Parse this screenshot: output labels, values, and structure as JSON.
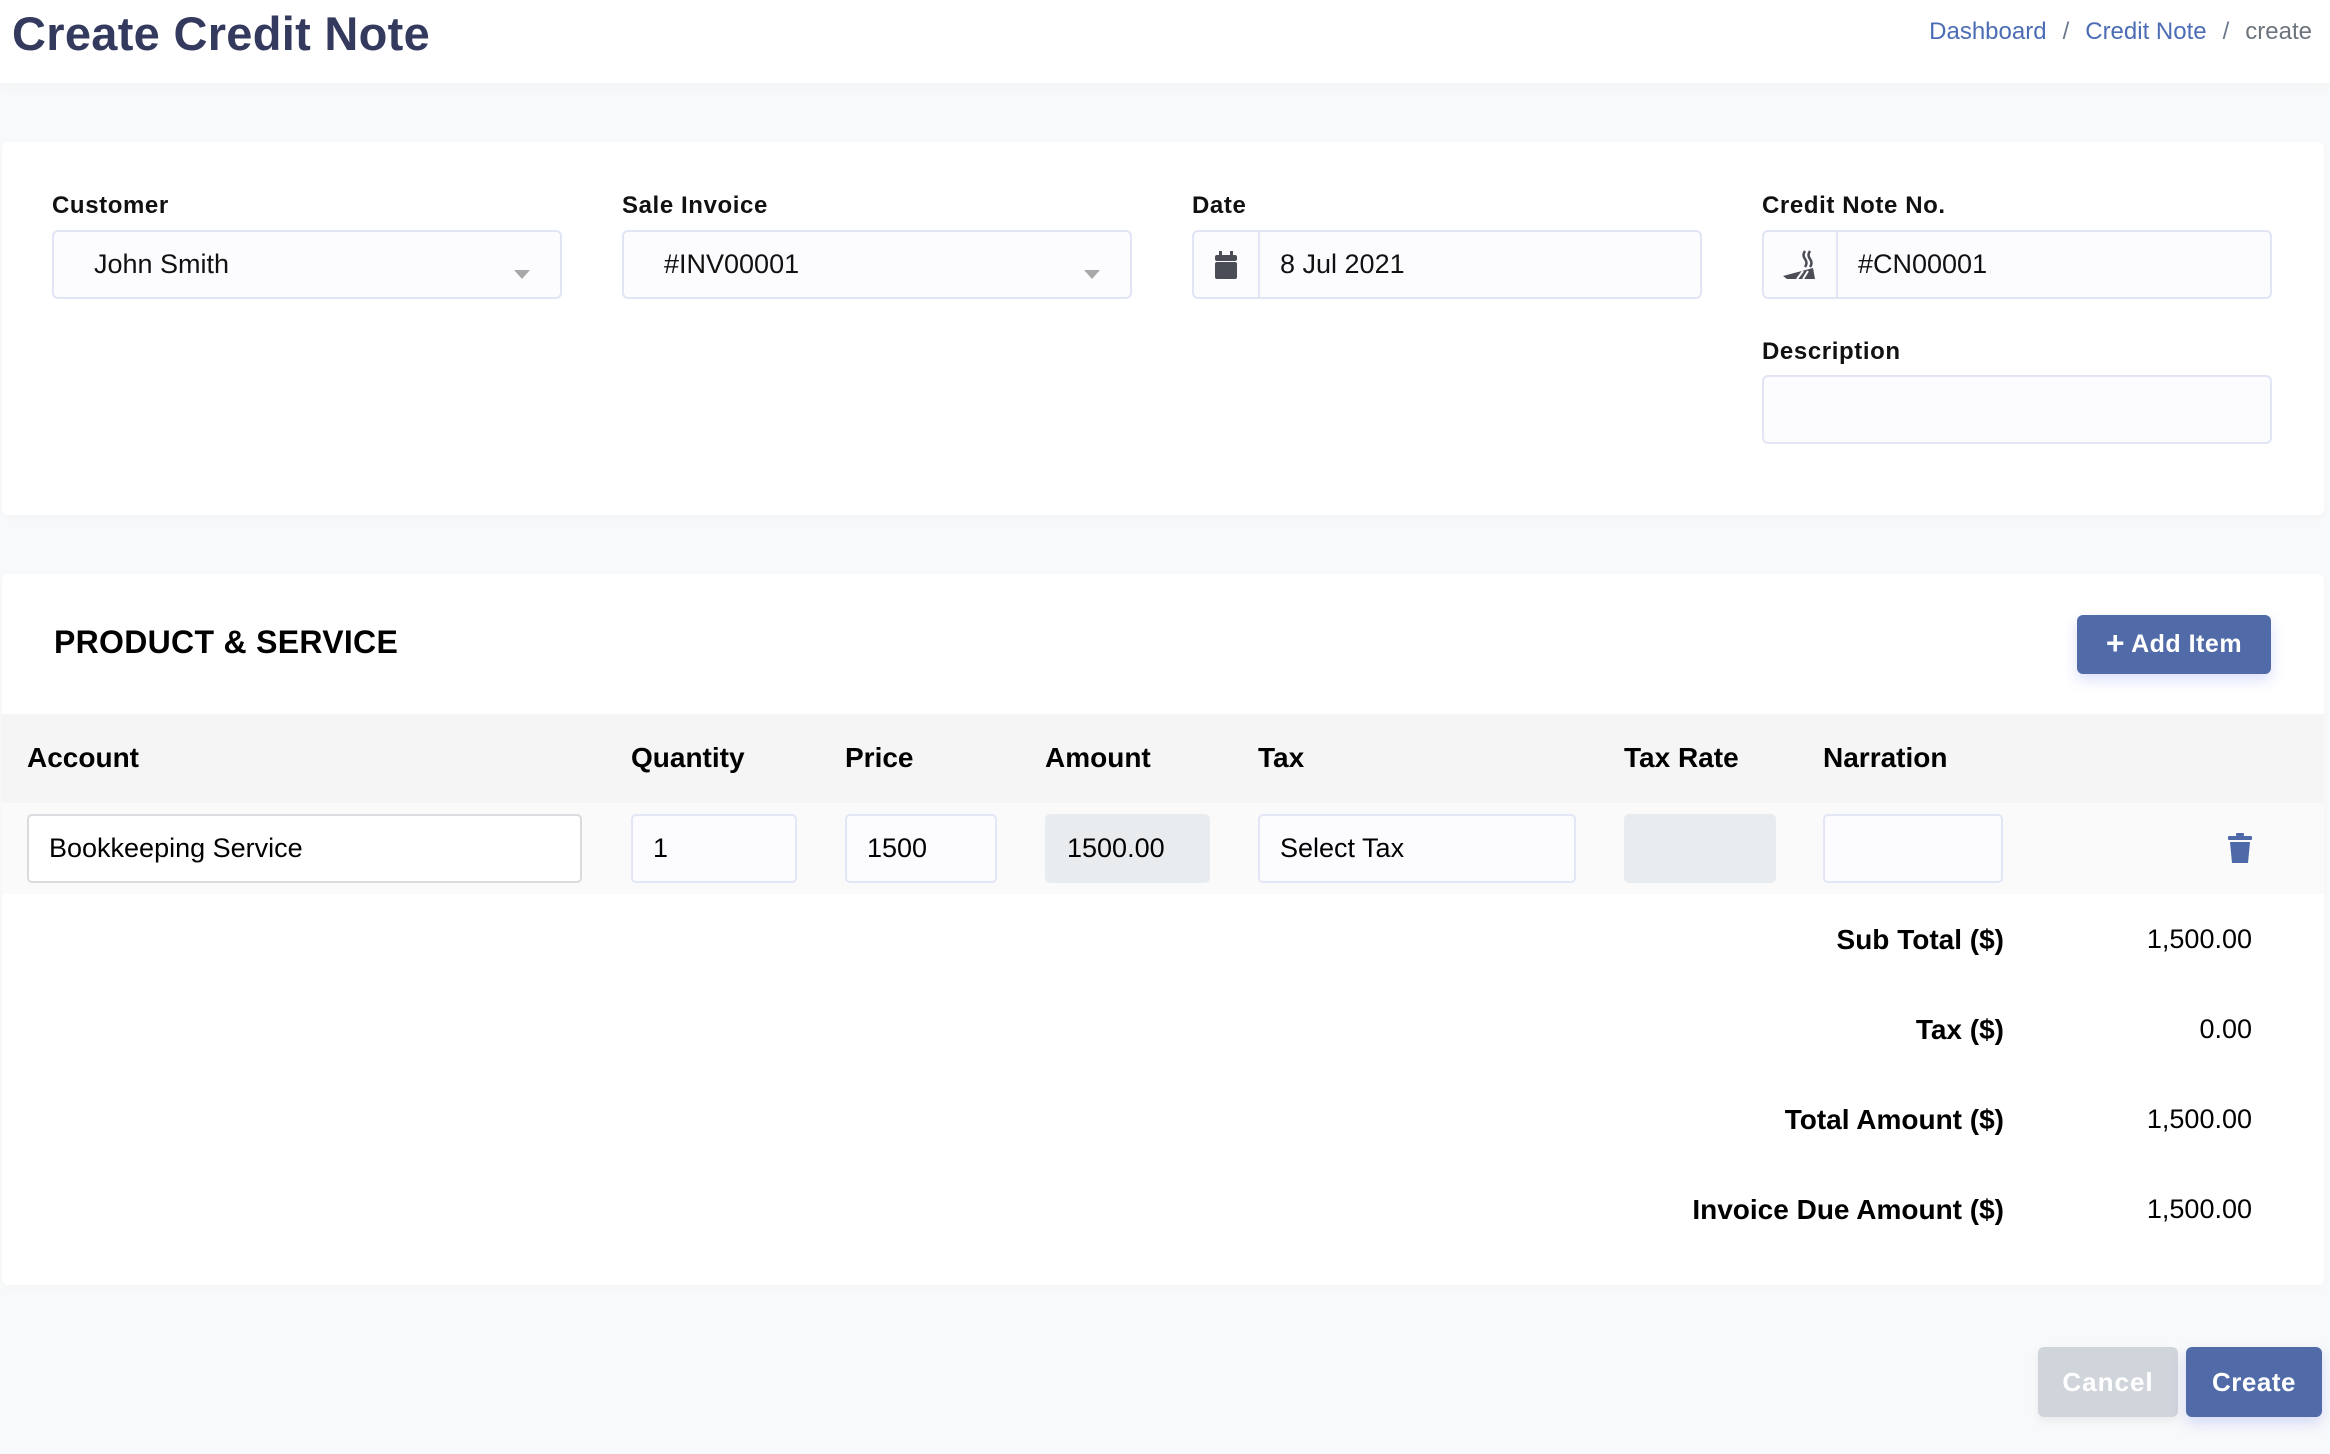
{
  "header": {
    "title": "Create Credit Note",
    "breadcrumb": [
      {
        "label": "Dashboard"
      },
      {
        "label": "Credit Note"
      },
      {
        "label": "create"
      }
    ],
    "separator": "/"
  },
  "form": {
    "customer": {
      "label": "Customer",
      "value": "John Smith",
      "icon": "caret-down-icon"
    },
    "sale_invoice": {
      "label": "Sale Invoice",
      "value": "#INV00001",
      "icon": "caret-down-icon"
    },
    "date": {
      "label": "Date",
      "value": "8 Jul 2021",
      "icon": "calendar-icon"
    },
    "credit_note_no": {
      "label": "Credit Note No.",
      "value": "#CN00001",
      "icon": "joint-icon"
    },
    "description": {
      "label": "Description",
      "value": ""
    }
  },
  "products": {
    "title": "PRODUCT & SERVICE",
    "add_item_label": "Add Item",
    "add_item_icon": "+",
    "columns": [
      "Account",
      "Quantity",
      "Price",
      "Amount",
      "Tax",
      "Tax Rate",
      "Narration"
    ],
    "rows": [
      {
        "account": "Bookkeeping Service",
        "quantity": "1",
        "price": "1500",
        "amount": "1500.00",
        "tax": "Select Tax",
        "tax_rate": "",
        "narration": "",
        "delete_icon": "trash-icon"
      }
    ]
  },
  "totals": [
    {
      "label": "Sub Total ($)",
      "value": "1,500.00"
    },
    {
      "label": "Tax ($)",
      "value": "0.00"
    },
    {
      "label": "Total Amount ($)",
      "value": "1,500.00"
    },
    {
      "label": "Invoice Due Amount ($)",
      "value": "1,500.00"
    }
  ],
  "actions": {
    "cancel_label": "Cancel",
    "create_label": "Create"
  },
  "colors": {
    "primary": "#516ba8",
    "title": "#343a5e",
    "link": "#4c6db5",
    "cancel": "#d0d4db"
  }
}
